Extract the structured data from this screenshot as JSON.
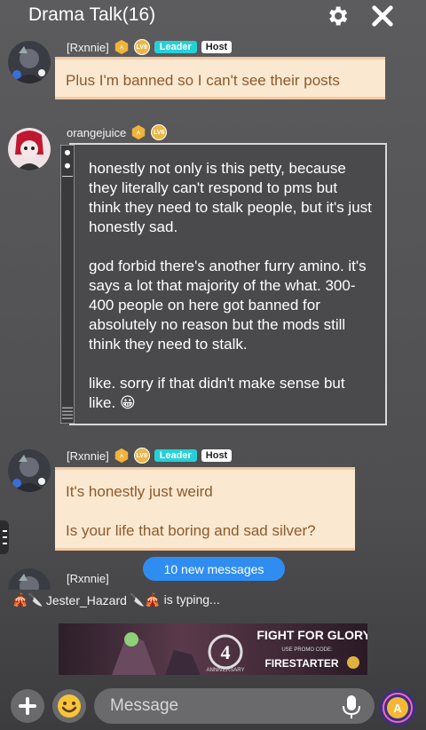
{
  "header": {
    "title": "Drama Talk(16)",
    "settings_icon": "gear-icon",
    "close_icon": "close-icon"
  },
  "messages": [
    {
      "author": "[Rxnnie]",
      "level_badge": "LV9",
      "roles": [
        "Leader",
        "Host"
      ],
      "lines": [
        "Plus I'm banned so I can't see their posts"
      ]
    },
    {
      "author": "orangejuice",
      "level_badge": "LV6",
      "roles": [],
      "paragraphs": [
        "honestly not only is this petty, because they literally can't respond to pms but think they need to stalk people, but it's just honestly sad.",
        "god forbid there's another furry amino. it's says a lot that majority of the what. 300-400 people on here got banned for absolutely no reason but the mods still think they need to stalk.",
        "like. sorry if that didn't make sense but like. 😀"
      ]
    },
    {
      "author": "[Rxnnie]",
      "level_badge": "LV9",
      "roles": [
        "Leader",
        "Host"
      ],
      "lines": [
        "It's honestly just weird",
        "Is your life that boring and sad silver?"
      ]
    },
    {
      "author": "[Rxnnie]"
    }
  ],
  "new_messages": "10 new messages",
  "typing": {
    "icon": "🎪🔪",
    "user": "Jester_Hazard",
    "suffix": "🔪🎪 is typing..."
  },
  "banner": {
    "headline": "FIGHT FOR GLORY!",
    "promo_label": "USE PROMO CODE:",
    "code": "FIRESTARTER",
    "anniversary_num": "4",
    "anniversary_word": "ANNIVERSARY"
  },
  "composer": {
    "placeholder": "Message",
    "add_icon": "plus-icon",
    "emoji_icon": "emoji-icon",
    "mic_icon": "microphone-icon",
    "coin_icon": "amino-coin-icon"
  },
  "colors": {
    "leader": "#25d0d6",
    "bubble_cream": "#fbe8d0",
    "bubble_text": "#8b5a2b",
    "pill": "#2f8df2"
  }
}
